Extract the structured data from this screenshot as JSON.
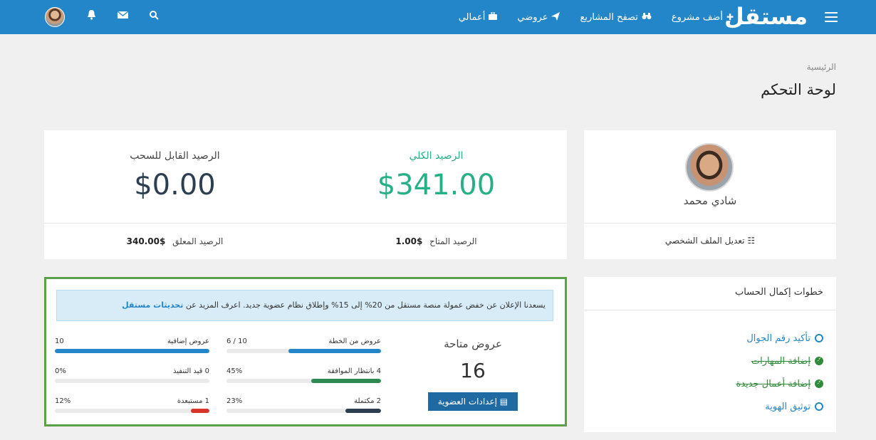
{
  "topbar": {
    "logo": "مستقل",
    "nav": [
      {
        "label": "أضف مشروع",
        "icon": "plus-icon"
      },
      {
        "label": "تصفح المشاريع",
        "icon": "binoculars-icon"
      },
      {
        "label": "عروضي",
        "icon": "paper-plane-icon"
      },
      {
        "label": "أعمالي",
        "icon": "briefcase-icon"
      }
    ],
    "icons": [
      "search-icon",
      "envelope-icon",
      "bell-icon"
    ]
  },
  "breadcrumb": "الرئيسية",
  "page_title": "لوحة التحكم",
  "profile": {
    "name": "شادي محمد",
    "edit_label": "تعديل الملف الشخصي"
  },
  "balance": {
    "total_label": "الرصيد الكلي",
    "total_amount": "$341.00",
    "withdraw_label": "الرصيد القابل للسحب",
    "withdraw_amount": "$0.00",
    "available_label": "الرصيد المتاح",
    "available_amount": "$1.00",
    "pending_label": "الرصيد المعلق",
    "pending_amount": "$340.00"
  },
  "steps": {
    "title": "خطوات إكمال الحساب",
    "items": [
      {
        "label": "تأكيد رقم الجوال",
        "done": false
      },
      {
        "label": "إضافة المهارات",
        "done": true
      },
      {
        "label": "إضافة أعمال جديدة",
        "done": true
      },
      {
        "label": "توثيق الهوية",
        "done": false
      }
    ]
  },
  "offers": {
    "announcement_text": "يسعدنا الإعلان عن خفض عمولة منصة مستقل من 20% إلى 15% وإطلاق نظام عضوية جديد. اعرف المزيد عن",
    "announcement_link": "تحديثات مستقل",
    "available_label": "عروض متاحة",
    "available_count": "16",
    "membership_button": "إعدادات العضوية",
    "stats": [
      {
        "label": "عروض من الخطة",
        "value": "10 / 6",
        "fill": 0.6,
        "color": "#2386c8"
      },
      {
        "label": "عروض إضافية",
        "value": "10",
        "fill": 1.0,
        "color": "#2386c8"
      },
      {
        "label": "4 بانتظار الموافقة",
        "value": "45%",
        "fill": 0.45,
        "color": "#2f8a52"
      },
      {
        "label": "0 قيد التنفيذ",
        "value": "0%",
        "fill": 0.0,
        "color": "#2386c8"
      },
      {
        "label": "2 مكتملة",
        "value": "23%",
        "fill": 0.23,
        "color": "#2c3e50"
      },
      {
        "label": "1 مستبعدة",
        "value": "12%",
        "fill": 0.12,
        "color": "#d9342b"
      }
    ]
  }
}
